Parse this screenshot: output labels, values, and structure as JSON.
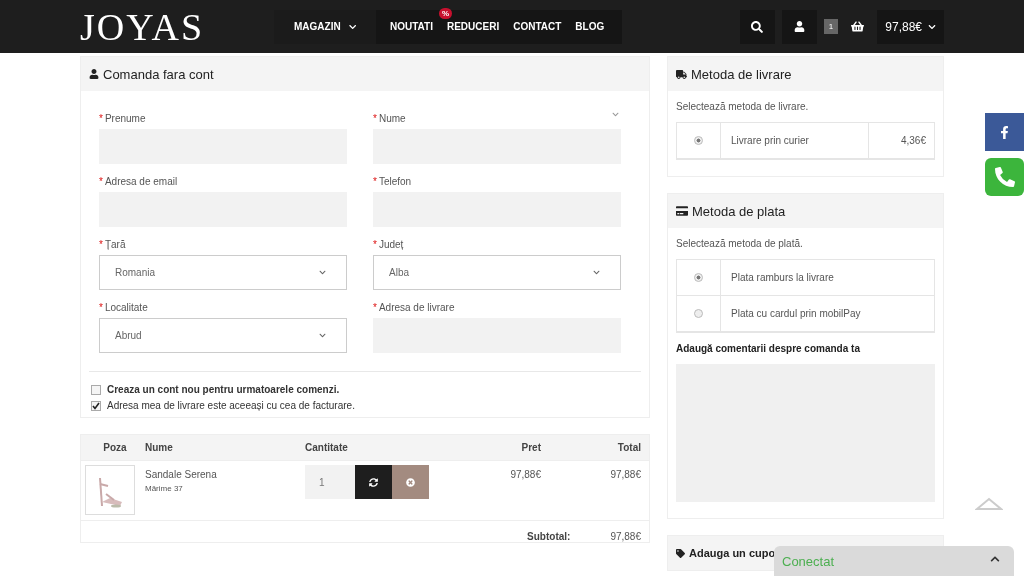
{
  "header": {
    "logo": "JOYAS",
    "nav": [
      {
        "label": "MAGAZIN",
        "kind": "dropdown"
      },
      {
        "label": "NOUTATI",
        "kind": "link"
      },
      {
        "label": "REDUCERI",
        "kind": "link",
        "badge": "%"
      },
      {
        "label": "CONTACT",
        "kind": "link"
      },
      {
        "label": "BLOG",
        "kind": "link"
      }
    ],
    "cart": {
      "count": "1",
      "total": "97,88€"
    }
  },
  "guest_form": {
    "title": "Comanda fara cont",
    "fields": [
      {
        "label": "Prenume",
        "kind": "text",
        "marker": "*"
      },
      {
        "label": "Nume",
        "kind": "text",
        "marker": "*"
      },
      {
        "label": "Adresa de email",
        "kind": "text",
        "marker": "*"
      },
      {
        "label": "Telefon",
        "kind": "text",
        "marker": "*"
      },
      {
        "label": "Țară",
        "kind": "select",
        "marker": "*",
        "value": "Romania"
      },
      {
        "label": "Județ",
        "kind": "select",
        "marker": "*",
        "value": "Alba"
      },
      {
        "label": "Localitate",
        "kind": "select",
        "marker": "*",
        "value": "Abrud"
      },
      {
        "label": "Adresa de livrare",
        "kind": "text",
        "marker": "*"
      }
    ],
    "options": [
      {
        "label": "Creaza un cont nou pentru urmatoarele comenzi.",
        "checked": false,
        "emphasis": true
      },
      {
        "label": "Adresa mea de livrare este aceeași cu cea de facturare.",
        "checked": true,
        "emphasis": false
      }
    ]
  },
  "cart_table": {
    "columns": [
      "Poza",
      "Nume",
      "Cantitate",
      "Pret",
      "Total"
    ],
    "rows": [
      {
        "name": "Sandale Serena",
        "variant": "Mărime 37",
        "quantity": "1",
        "price": "97,88€",
        "total": "97,88€"
      }
    ],
    "subtotal": {
      "label": "Subtotal:",
      "value": "97,88€"
    }
  },
  "delivery": {
    "title": "Metoda de livrare",
    "hint": "Selectează metoda de livrare.",
    "options": [
      {
        "label": "Livrare prin curier",
        "price": "4,36€",
        "selected": true
      }
    ]
  },
  "payment": {
    "title": "Metoda de plata",
    "hint": "Selectează metoda de plată.",
    "options": [
      {
        "label": "Plata ramburs la livrare",
        "selected": true
      },
      {
        "label": "Plata cu cardul prin mobilPay",
        "selected": false
      }
    ],
    "comment_label": "Adaugă comentarii despre comanda ta"
  },
  "coupon": {
    "title": "Adauga un cupo"
  },
  "chat": {
    "label": "Conectat"
  }
}
